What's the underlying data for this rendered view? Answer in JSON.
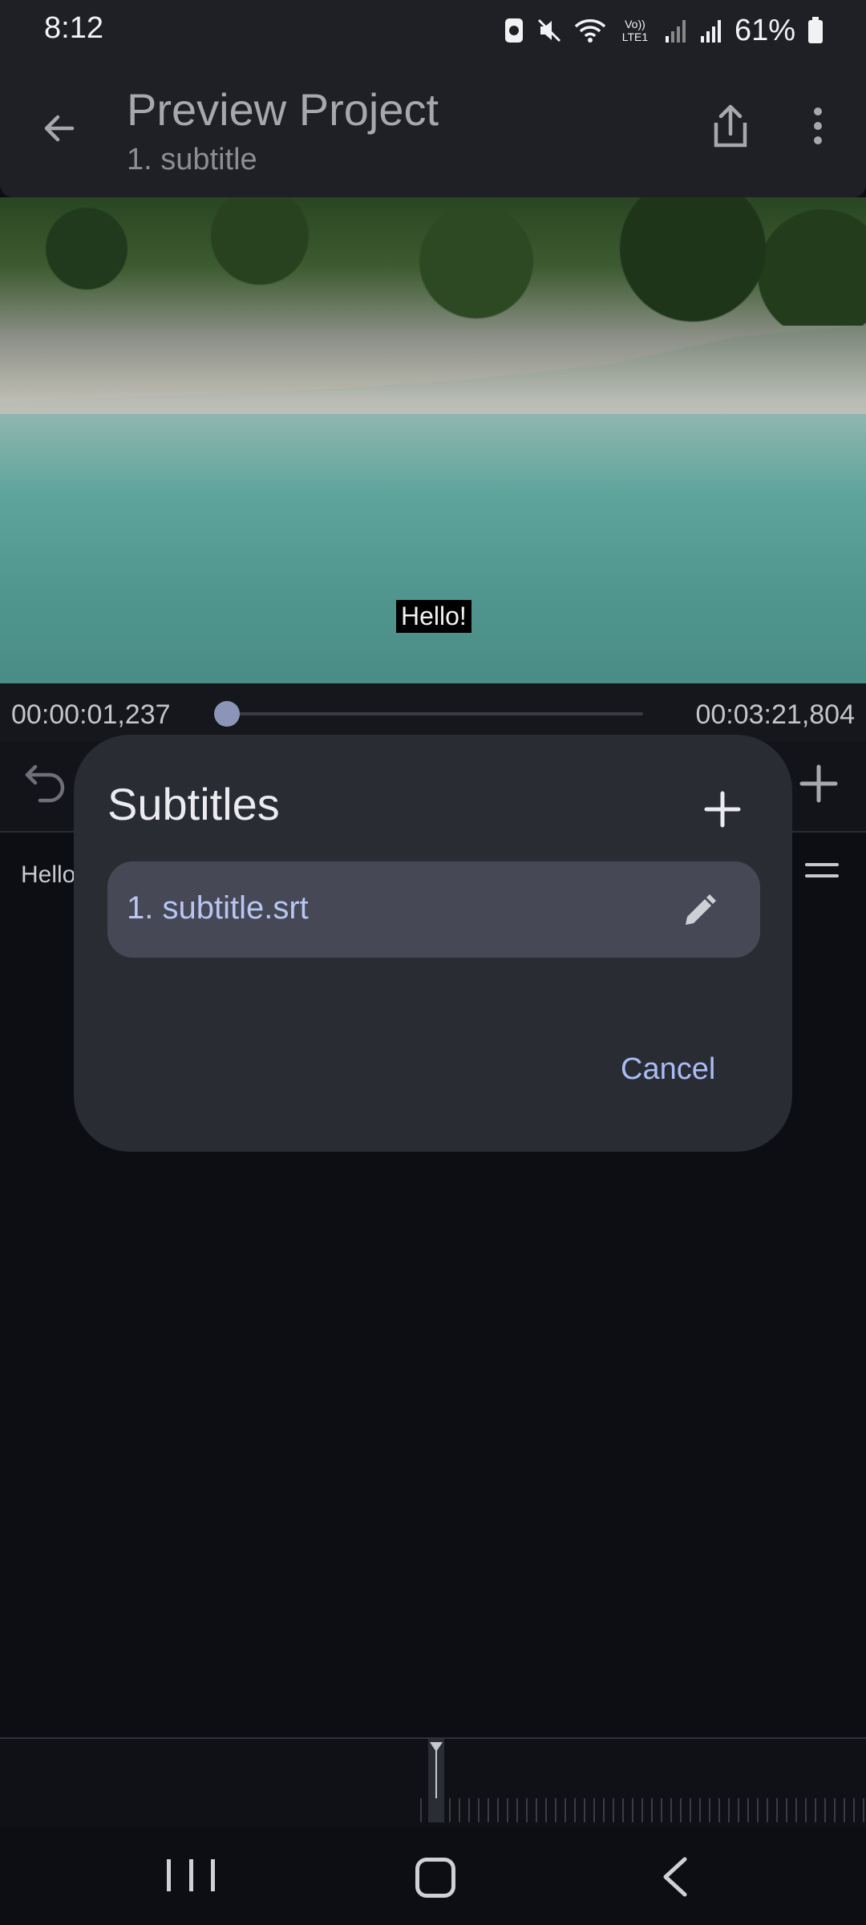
{
  "status_bar": {
    "time": "8:12",
    "battery": "61%",
    "lte_label": "Vo)) LTE1"
  },
  "app_bar": {
    "title": "Preview Project",
    "subtitle": "1. subtitle"
  },
  "video": {
    "caption": "Hello!"
  },
  "player": {
    "current_time": "00:00:01,237",
    "total_time": "00:03:21,804",
    "progress": 0.01
  },
  "list": {
    "first_row_text": "Hello"
  },
  "dialog": {
    "title": "Subtitles",
    "items": [
      {
        "label": "1. subtitle.srt"
      }
    ],
    "cancel_label": "Cancel"
  },
  "icons": {
    "back": "arrow-left-icon",
    "share": "share-icon",
    "more": "more-vertical-icon",
    "undo": "undo-icon",
    "add": "plus-icon",
    "edit": "pencil-icon",
    "drag": "drag-handle-icon"
  },
  "colors": {
    "accent": "#aabcf4",
    "dialog_bg": "#2a2c34",
    "item_bg": "#464856",
    "app_bar_bg": "#1f2025"
  }
}
